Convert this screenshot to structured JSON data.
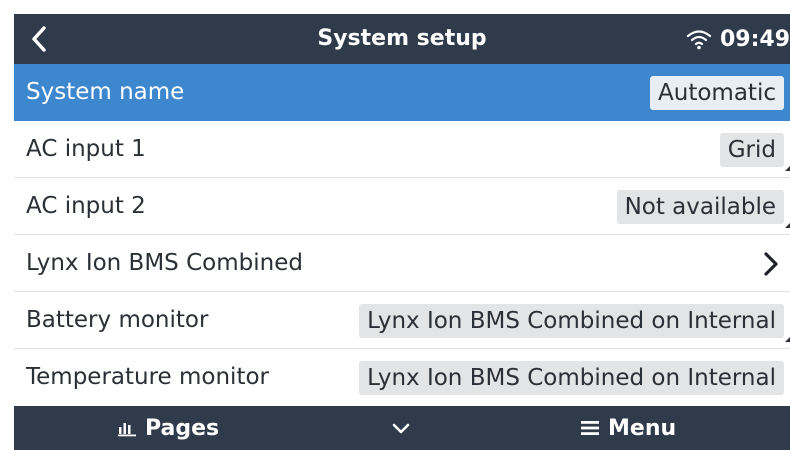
{
  "header": {
    "title": "System setup",
    "time": "09:49",
    "icons": {
      "back": "chevron-left-icon",
      "wifi": "wifi-icon"
    }
  },
  "rows": [
    {
      "label": "System name",
      "value": "Automatic",
      "selected": true
    },
    {
      "label": "AC input 1",
      "value": "Grid"
    },
    {
      "label": "AC input 2",
      "value": "Not available"
    },
    {
      "label": "Lynx Ion BMS Combined",
      "icon": "chevron-right-icon"
    },
    {
      "label": "Battery monitor",
      "value": "Lynx Ion BMS Combined on Internal"
    },
    {
      "label": "Temperature monitor",
      "value": "Lynx Ion BMS Combined on Internal"
    }
  ],
  "footer": {
    "pages_label": "Pages",
    "menu_label": "Menu",
    "icons": {
      "pages": "bar-chart-icon",
      "down": "chevron-down-icon",
      "menu": "hamburger-icon"
    }
  },
  "colors": {
    "header_bg": "#2f3a4b",
    "selected_row_bg": "#3d87cf",
    "value_bg": "#e3e4e6"
  }
}
